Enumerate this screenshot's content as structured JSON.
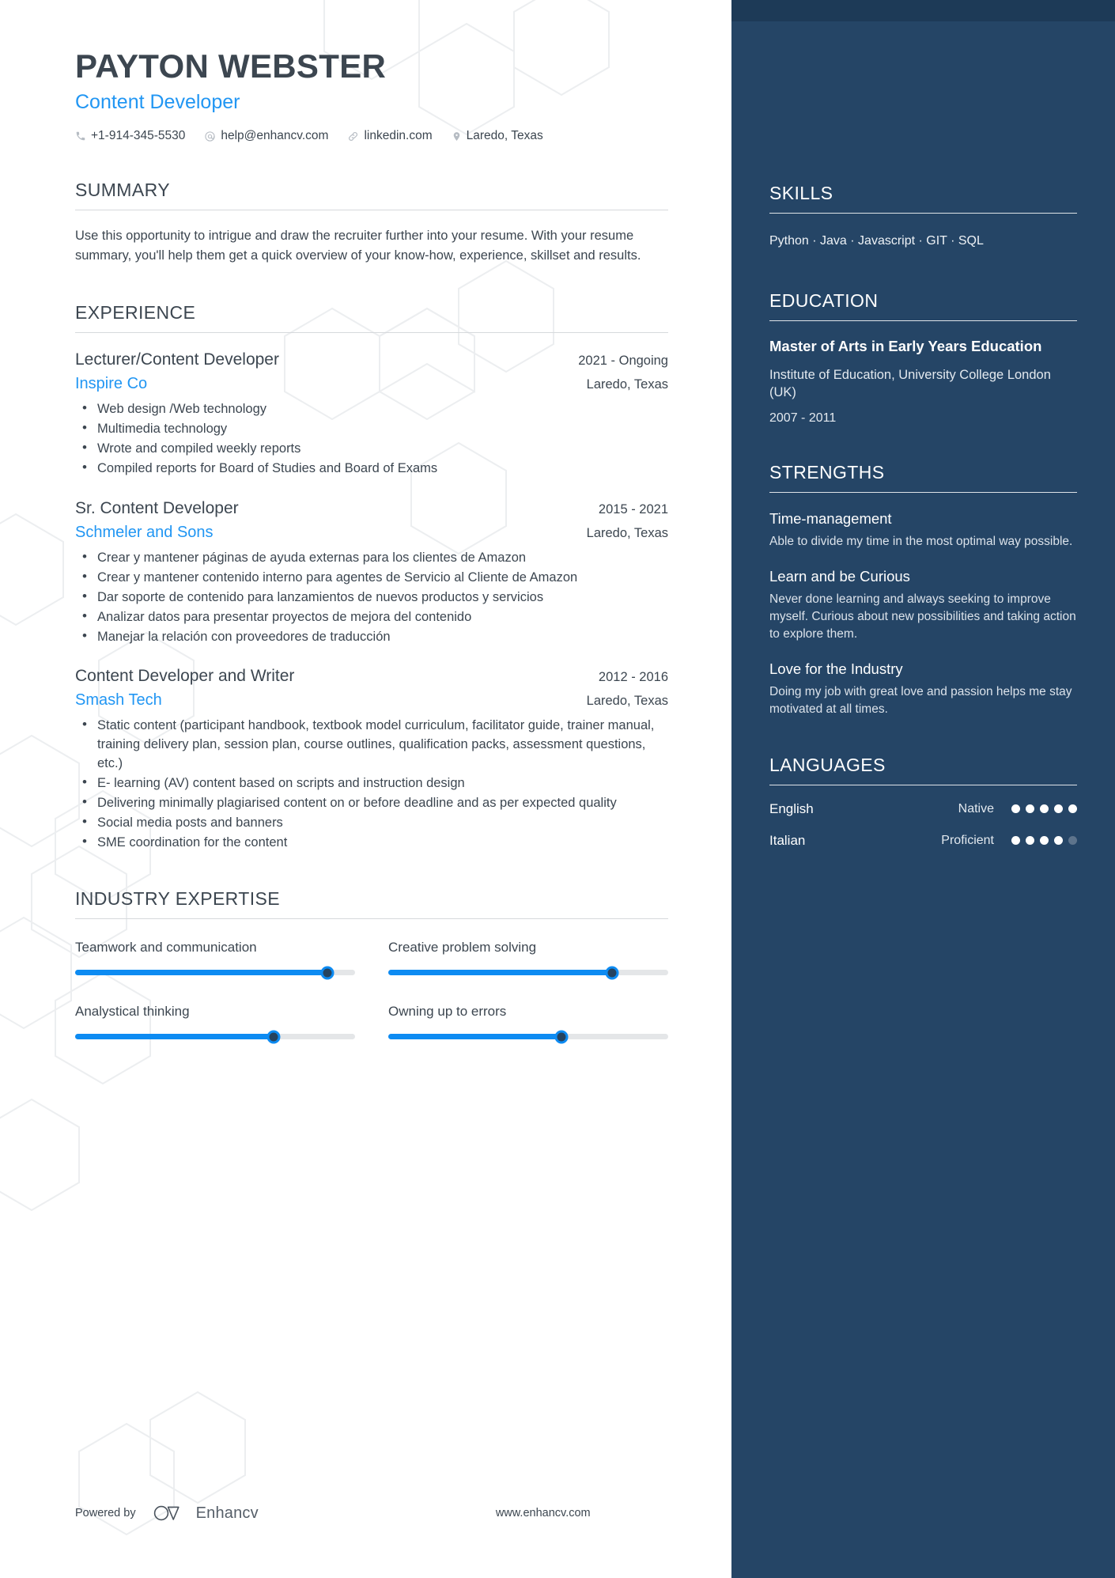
{
  "header": {
    "name": "PAYTON WEBSTER",
    "job_title": "Content Developer",
    "contacts": [
      {
        "icon": "phone-icon",
        "text": "+1-914-345-5530"
      },
      {
        "icon": "email-icon",
        "text": "help@enhancv.com"
      },
      {
        "icon": "link-icon",
        "text": "linkedin.com"
      },
      {
        "icon": "location-pin-icon",
        "text": "Laredo, Texas"
      }
    ]
  },
  "summary": {
    "title": "SUMMARY",
    "text": "Use this opportunity to intrigue and draw the recruiter further into your resume. With your resume summary, you'll help them get a quick overview of your know-how, experience, skillset and results."
  },
  "experience": {
    "title": "EXPERIENCE",
    "entries": [
      {
        "role": "Lecturer/Content Developer",
        "date": "2021 - Ongoing",
        "company": "Inspire Co",
        "location": "Laredo, Texas",
        "bullets": [
          "Web design /Web technology",
          "Multimedia technology",
          "Wrote and compiled weekly reports",
          "Compiled reports for Board of Studies and Board of Exams"
        ]
      },
      {
        "role": "Sr. Content Developer",
        "date": "2015 - 2021",
        "company": "Schmeler and Sons",
        "location": "Laredo, Texas",
        "bullets": [
          "Crear y mantener páginas de ayuda externas para los clientes de Amazon",
          "Crear y mantener contenido interno para agentes de Servicio al Cliente de Amazon",
          "Dar soporte de contenido para lanzamientos de nuevos productos y servicios",
          "Analizar datos para presentar proyectos de mejora del contenido",
          "Manejar la relación con proveedores de traducción"
        ]
      },
      {
        "role": "Content Developer and Writer",
        "date": "2012 - 2016",
        "company": "Smash Tech",
        "location": "Laredo, Texas",
        "bullets": [
          "Static content (participant handbook, textbook model curriculum, facilitator guide, trainer manual, training delivery plan, session plan, course outlines, qualification packs, assessment questions, etc.)",
          "E- learning (AV) content based on scripts and instruction design",
          "Delivering minimally plagiarised content on or before deadline and as per expected quality",
          "Social media posts and banners",
          "SME coordination for the content"
        ]
      }
    ]
  },
  "industry_expertise": {
    "title": "INDUSTRY EXPERTISE",
    "items": [
      {
        "label": "Teamwork and communication",
        "value": 90
      },
      {
        "label": "Creative problem solving",
        "value": 80
      },
      {
        "label": "Analystical thinking",
        "value": 71
      },
      {
        "label": "Owning up to errors",
        "value": 62
      }
    ]
  },
  "skills": {
    "title": "SKILLS",
    "text": "Python · Java · Javascript · GIT · SQL"
  },
  "education": {
    "title": "EDUCATION",
    "degree": "Master of Arts in Early Years Education",
    "school": "Institute of Education, University College London (UK)",
    "date": "2007 - 2011"
  },
  "strengths": {
    "title": "STRENGTHS",
    "items": [
      {
        "name": "Time-management",
        "description": "Able to divide my time in the most optimal way possible."
      },
      {
        "name": "Learn and be Curious",
        "description": "Never done learning and always seeking to improve myself. Curious about new possibilities and taking action to explore them."
      },
      {
        "name": "Love for the Industry",
        "description": "Doing my job with great love and passion helps me stay motivated at all times."
      }
    ]
  },
  "languages": {
    "title": "LANGUAGES",
    "items": [
      {
        "name": "English",
        "level": "Native",
        "filled": 5,
        "total": 5
      },
      {
        "name": "Italian",
        "level": "Proficient",
        "filled": 4,
        "total": 5
      }
    ]
  },
  "footer": {
    "powered_by": "Powered by",
    "brand": "Enhancv",
    "website": "www.enhancv.com"
  },
  "colors": {
    "accent_blue": "#2196f3",
    "slider_blue": "#0d8bf2",
    "sidebar_navy": "#254566",
    "text_dark": "#3c4650"
  }
}
